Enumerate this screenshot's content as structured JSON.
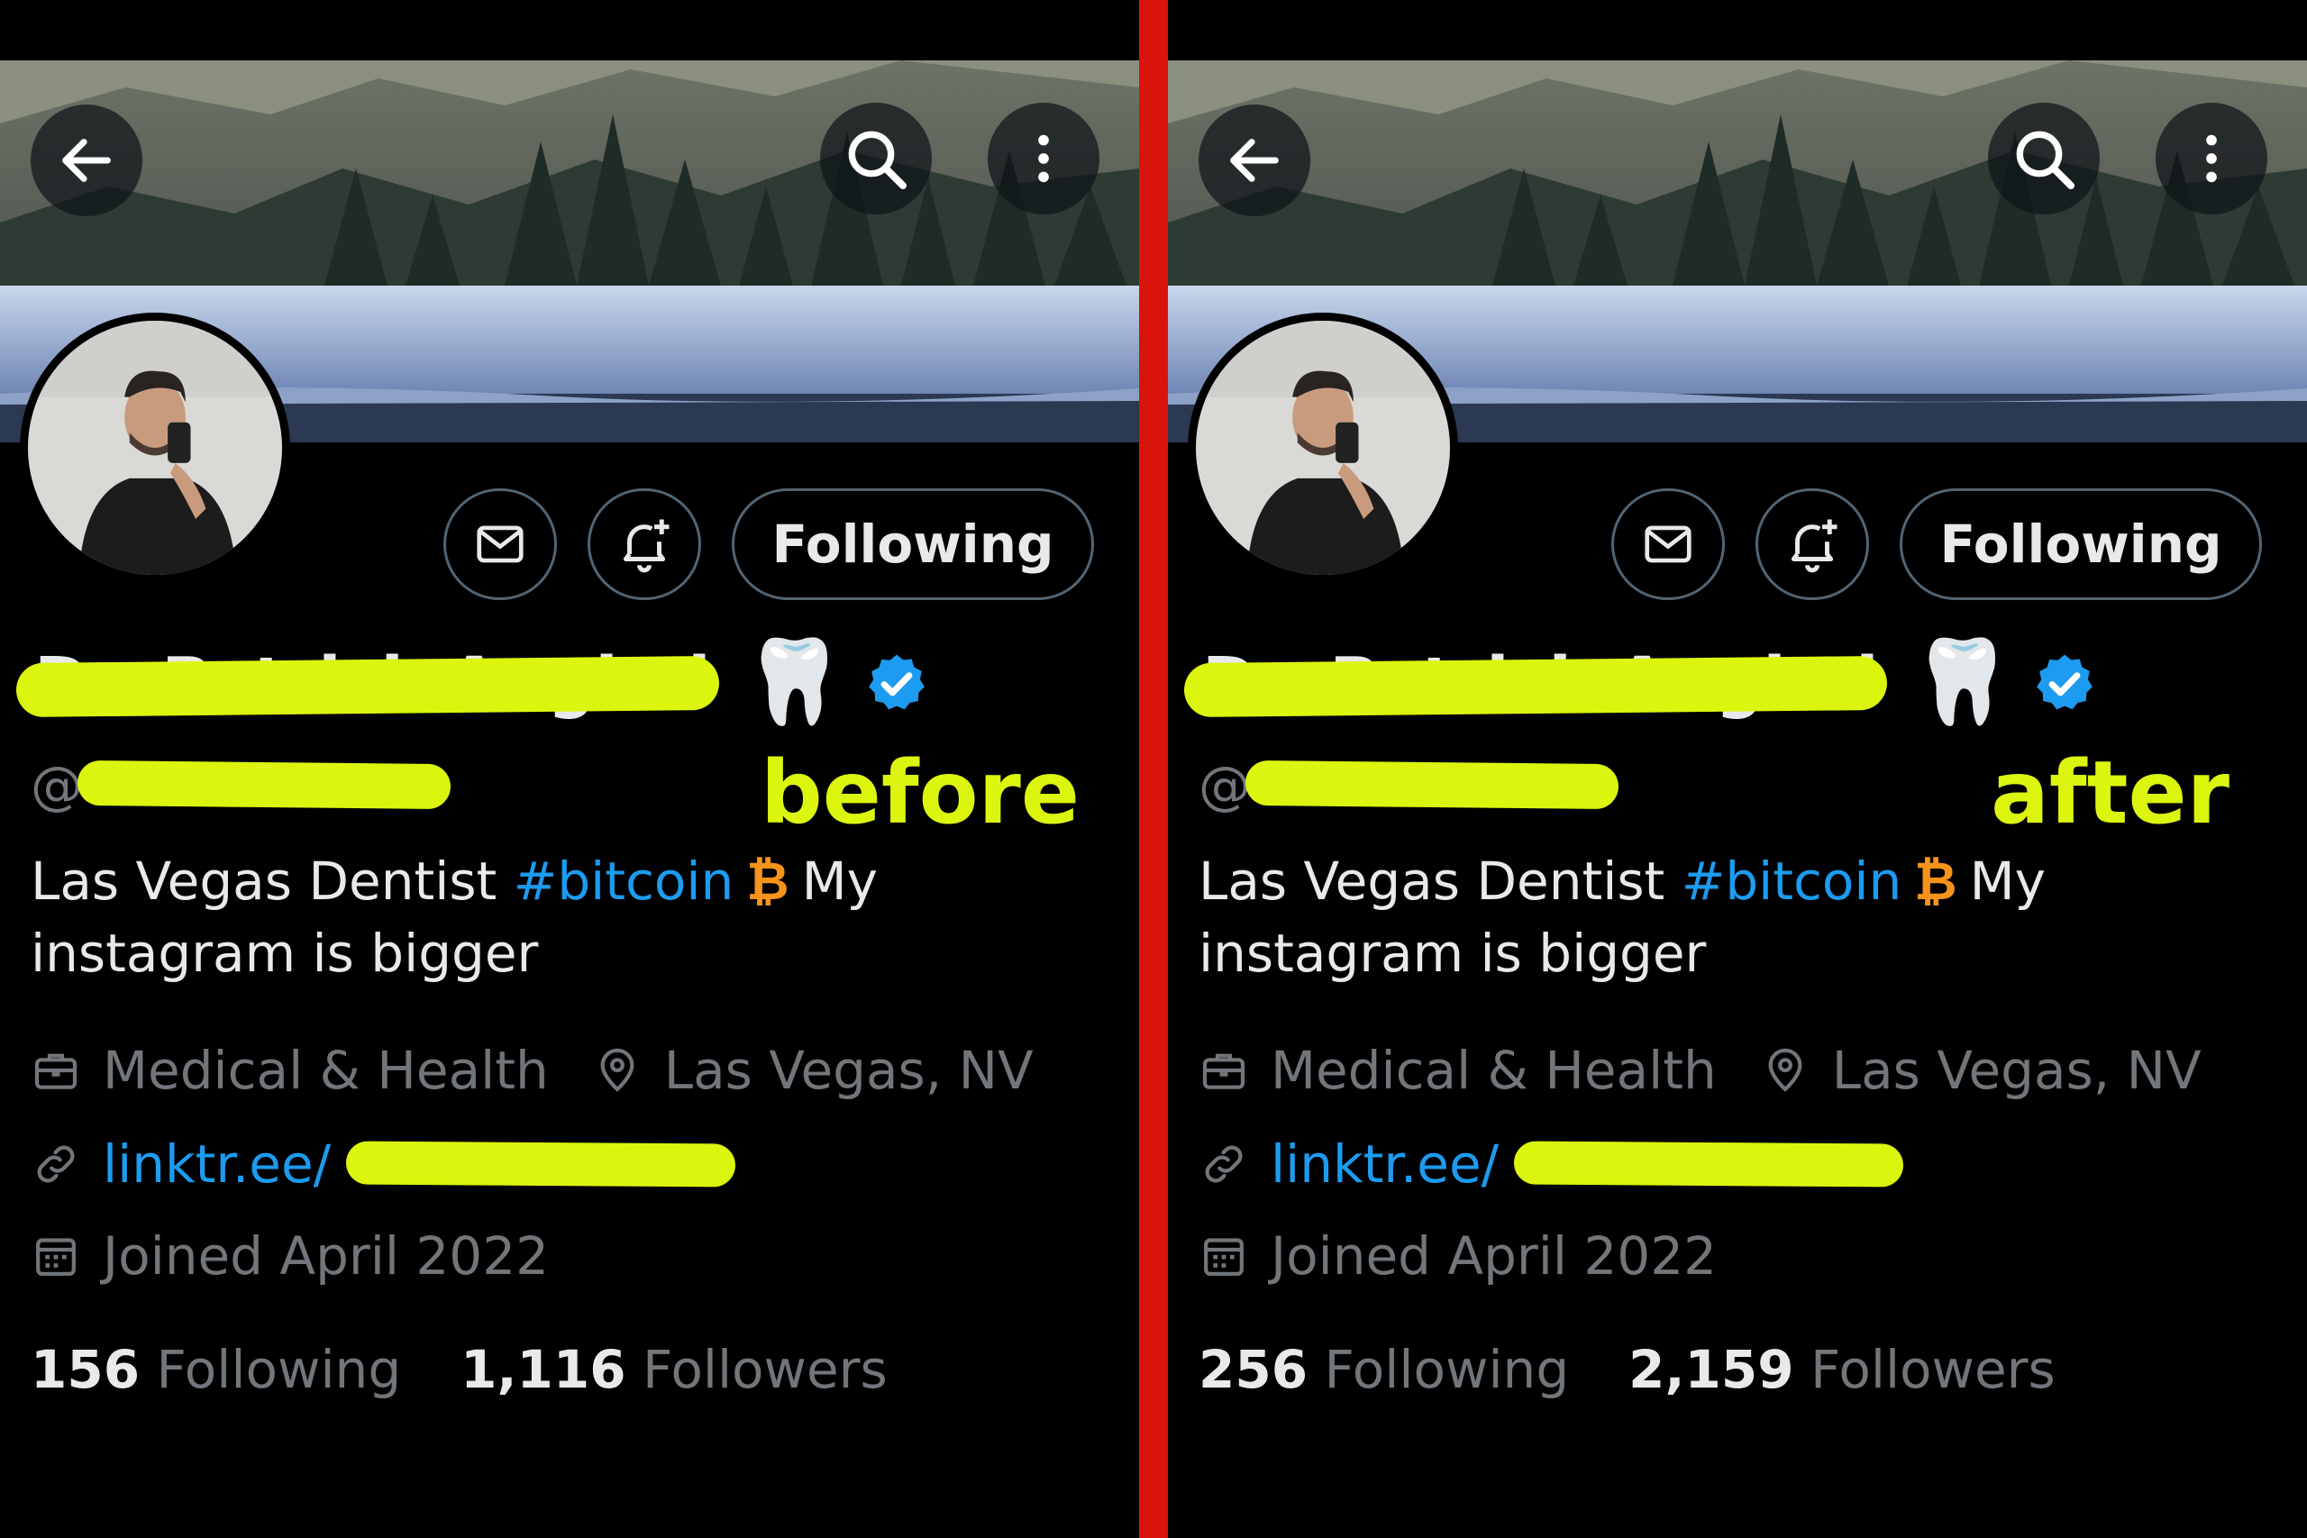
{
  "panels": [
    {
      "annotation_label": "before",
      "header": {
        "follow_button_label": "Following"
      },
      "profile": {
        "display_name": "Dr. Patrick Anghel",
        "name_emoji": "🦷",
        "handle_prefix": "@",
        "bio_text_1": "Las Vegas Dentist ",
        "bio_hashtag": "#bitcoin",
        "bio_symbol": "₿",
        "bio_text_2": "My instagram is bigger",
        "category": "Medical & Health",
        "location": "Las Vegas, NV",
        "link_prefix": "linktr.ee/",
        "joined": "Joined April 2022"
      },
      "stats": {
        "following_count": "156",
        "following_label": "Following",
        "followers_count": "1,116",
        "followers_label": "Followers"
      }
    },
    {
      "annotation_label": "after",
      "header": {
        "follow_button_label": "Following"
      },
      "profile": {
        "display_name": "Dr. Patrick Anghel",
        "name_emoji": "🦷",
        "handle_prefix": "@",
        "bio_text_1": "Las Vegas Dentist ",
        "bio_hashtag": "#bitcoin",
        "bio_symbol": "₿",
        "bio_text_2": "My instagram is bigger",
        "category": "Medical & Health",
        "location": "Las Vegas, NV",
        "link_prefix": "linktr.ee/",
        "joined": "Joined April 2022"
      },
      "stats": {
        "following_count": "256",
        "following_label": "Following",
        "followers_count": "2,159",
        "followers_label": "Followers"
      }
    }
  ],
  "icons": {
    "back": "arrow-left-icon",
    "search": "search-icon",
    "more": "more-vertical-icon",
    "message": "envelope-icon",
    "notify": "bell-plus-icon",
    "verified": "verified-badge-icon",
    "category": "briefcase-icon",
    "location": "location-pin-icon",
    "link": "link-icon",
    "calendar": "calendar-icon"
  },
  "colors": {
    "background": "#000000",
    "text_primary": "#e7e9ea",
    "text_secondary": "#71767b",
    "accent_blue": "#1d9bf0",
    "bitcoin_orange": "#f7931a",
    "highlighter": "#dcf50f",
    "divider_red": "#d9140c"
  }
}
